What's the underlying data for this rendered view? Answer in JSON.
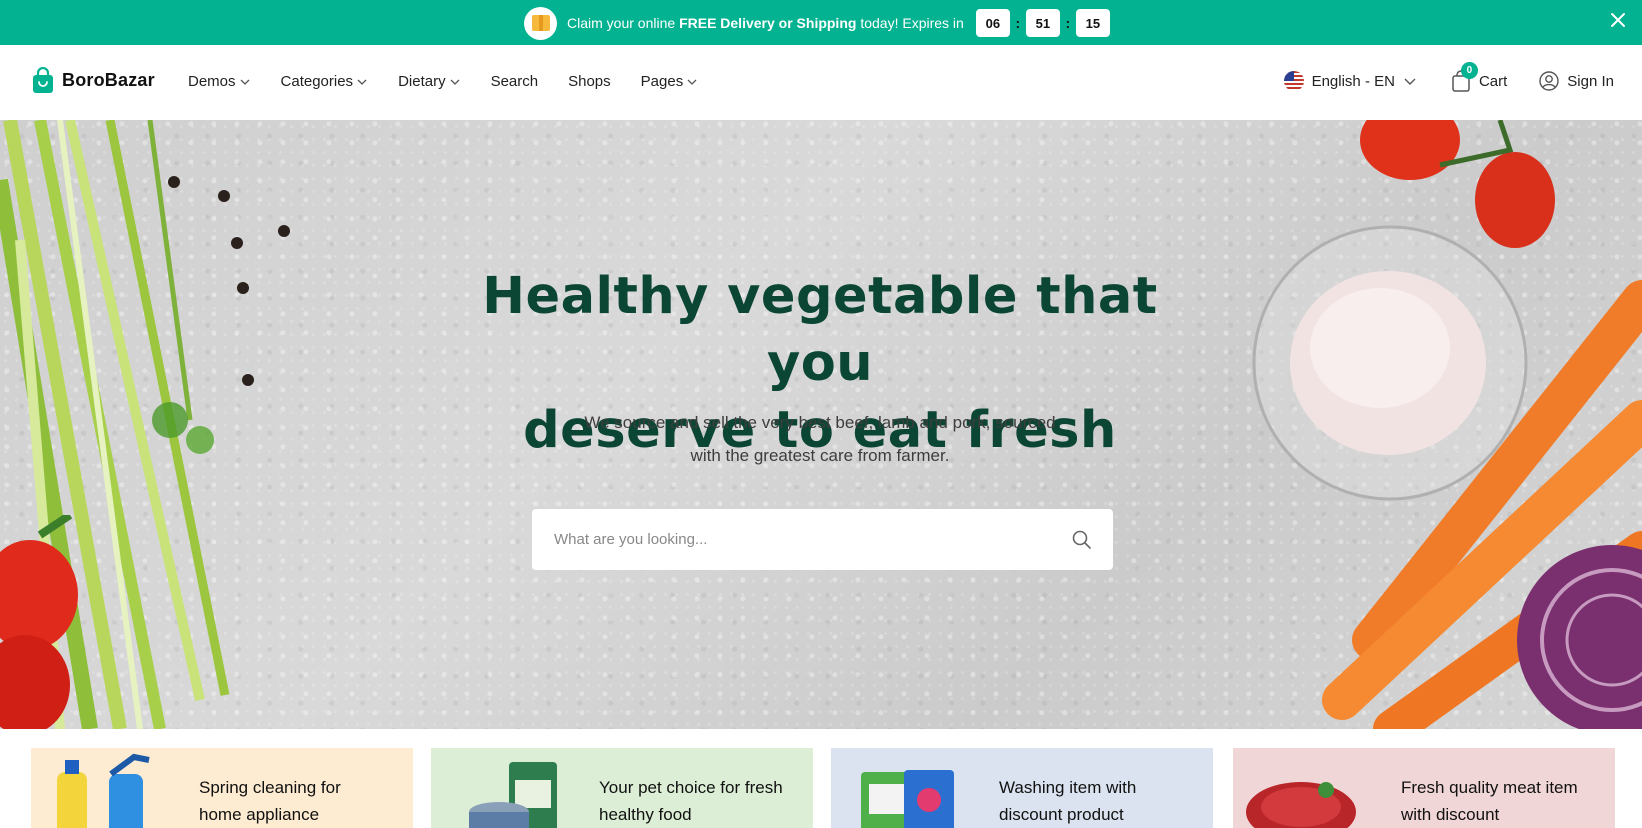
{
  "promo": {
    "text_pre": "Claim your online ",
    "text_bold": "FREE Delivery or Shipping",
    "text_post": " today! Expires in",
    "timer": {
      "hours": "06",
      "minutes": "51",
      "seconds": "15"
    },
    "timer_separator": ":",
    "icon": "package-icon",
    "close_icon": "close-icon",
    "color": "#02b290"
  },
  "header": {
    "logo_text": "BoroBazar",
    "logo_icon": "shopping-bag-icon",
    "nav": [
      {
        "label": "Demos",
        "has_dropdown": true
      },
      {
        "label": "Categories",
        "has_dropdown": true
      },
      {
        "label": "Dietary",
        "has_dropdown": true
      },
      {
        "label": "Search",
        "has_dropdown": false
      },
      {
        "label": "Shops",
        "has_dropdown": false
      },
      {
        "label": "Pages",
        "has_dropdown": true
      }
    ],
    "language": "English - EN",
    "language_icon": "us-flag-icon",
    "cart_label": "Cart",
    "cart_count": "0",
    "cart_icon": "shopping-bag-icon",
    "signin_label": "Sign In",
    "signin_icon": "user-icon"
  },
  "hero": {
    "title_line1": "Healthy vegetable that you",
    "title_line2": "deserve to eat fresh",
    "subtitle_line1": "We source and sell the very best beef, lamb and pork, sourced",
    "subtitle_line2": "with the greatest care from farmer.",
    "search_placeholder": "What are you looking...",
    "search_icon": "search-icon",
    "title_color": "#0b4635"
  },
  "cards": [
    {
      "line1": "Spring cleaning for",
      "line2": "home appliance",
      "bg": "#fdebd2",
      "image": "cleaning-products-image"
    },
    {
      "line1": "Your pet choice for fresh",
      "line2": "healthy food",
      "bg": "#dcefd6",
      "image": "pet-food-image"
    },
    {
      "line1": "Washing item with",
      "line2": "discount product",
      "bg": "#dae3ef",
      "image": "detergent-image"
    },
    {
      "line1": "Fresh quality meat item",
      "line2": "with discount",
      "bg": "#f0d6d6",
      "image": "meat-image"
    }
  ]
}
